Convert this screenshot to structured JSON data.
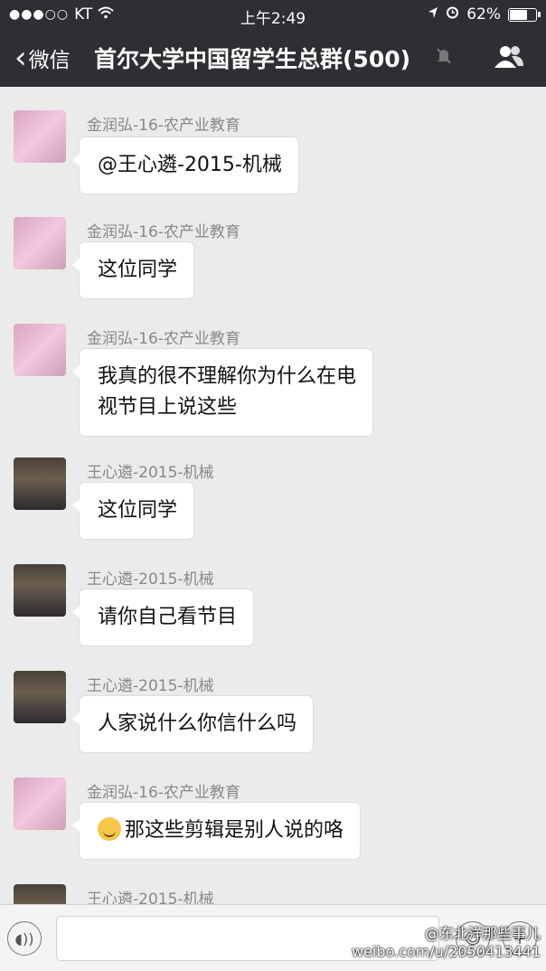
{
  "status_bar": {
    "carrier": "KT",
    "signal_dots": "●●●○○",
    "time": "上午2:49",
    "battery": "62%"
  },
  "nav": {
    "back_label": "微信",
    "title": "首尔大学中国留学生总群(500)"
  },
  "messages": [
    {
      "sender": "金润弘-16-农产业教育",
      "avatar": "pink-avatar",
      "lines": [
        "@王心遴-2015-机械"
      ]
    },
    {
      "sender": "金润弘-16-农产业教育",
      "avatar": "pink-avatar",
      "lines": [
        "这位同学"
      ]
    },
    {
      "sender": "金润弘-16-农产业教育",
      "avatar": "pink-avatar",
      "lines": [
        "我真的很不理解你为什么在电",
        "视节目上说这些"
      ]
    },
    {
      "sender": "王心遴-2015-机械",
      "avatar": "man-avatar",
      "lines": [
        "这位同学"
      ]
    },
    {
      "sender": "王心遴-2015-机械",
      "avatar": "man-avatar",
      "lines": [
        "请你自己看节目"
      ]
    },
    {
      "sender": "王心遴-2015-机械",
      "avatar": "man-avatar",
      "lines": [
        "人家说什么你信什么吗"
      ]
    },
    {
      "sender": "金润弘-16-农产业教育",
      "avatar": "pink-avatar",
      "lines": [
        "那这些剪辑是别人说的咯"
      ],
      "emoji": "smile-emoji"
    },
    {
      "sender": "王心遴-2015-机械",
      "avatar": "man-avatar",
      "lines": []
    }
  ],
  "watermark": {
    "line1": "@东北洋那些事儿",
    "line2": "weibo.com/u/2050413441"
  },
  "colors": {
    "nav_bg": "#2e2e33",
    "chat_bg": "#ebebeb",
    "bubble_bg": "#ffffff"
  }
}
